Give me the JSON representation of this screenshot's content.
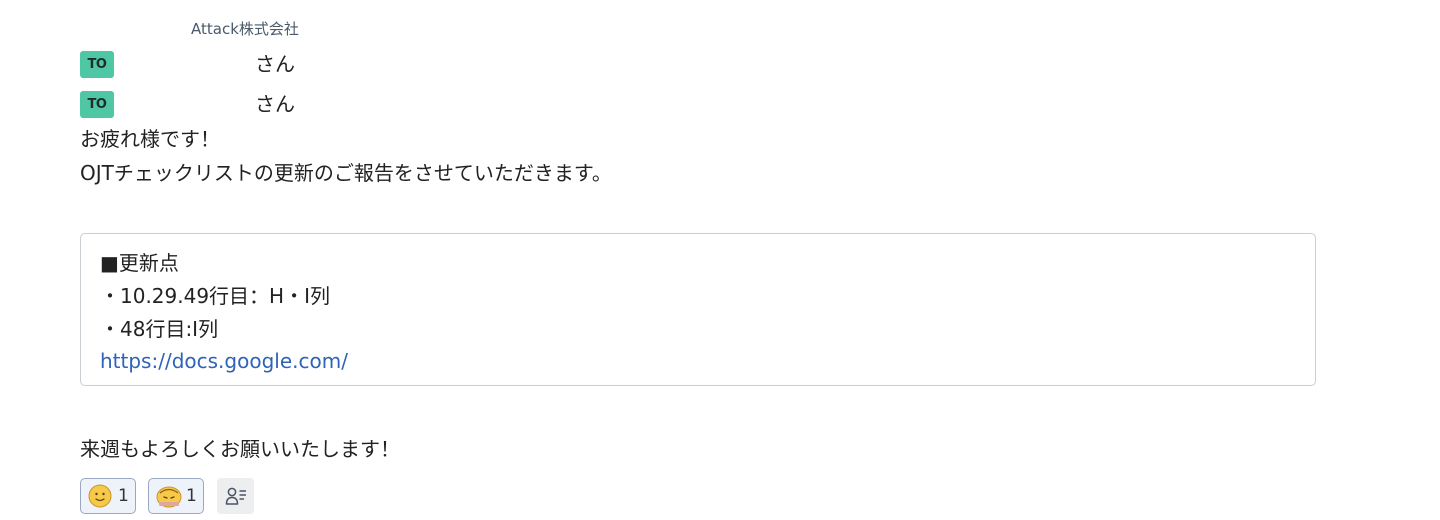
{
  "message": {
    "company": "Attack株式会社",
    "to": [
      {
        "badge": "TO",
        "name": "さん"
      },
      {
        "badge": "TO",
        "name": "さん"
      }
    ],
    "lines": [
      "お疲れ様です！",
      "OJTチェックリストの更新のご報告をさせていただきます。"
    ],
    "quote": {
      "lines": [
        "■更新点",
        "・10.29.49行目：H・I列",
        "・48行目:I列"
      ],
      "link": "https://docs.google.com/"
    },
    "closing": "来週もよろしくお願いいたします！"
  },
  "reactions": [
    {
      "icon": "smile-face-icon",
      "count": "1"
    },
    {
      "icon": "bowing-face-icon",
      "count": "1"
    }
  ],
  "reaction_list_icon": "reaction-users-icon",
  "colors": {
    "to_badge": "#4fc7a4",
    "link": "#2f63b8",
    "reaction_border": "#9aa8c4",
    "reaction_bg": "#eef3fb"
  }
}
